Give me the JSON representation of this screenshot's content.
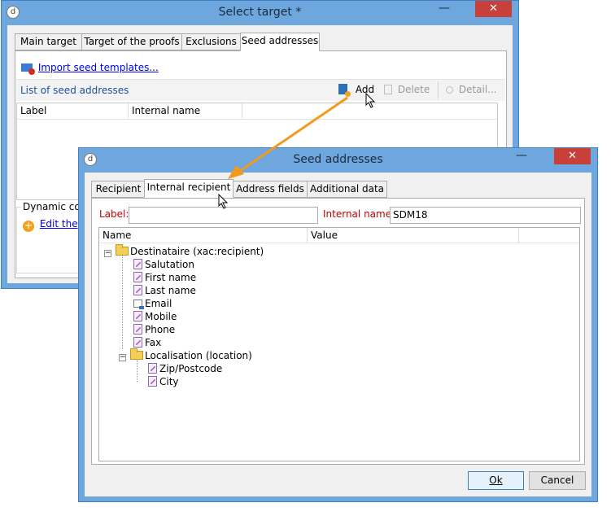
{
  "back_window": {
    "title": "Select target *",
    "close_glyph": "✕",
    "minimize_glyph": "—",
    "tabs": [
      "Main target",
      "Target of the proofs",
      "Exclusions",
      "Seed addresses"
    ],
    "import_link": "Import seed templates...",
    "list_label": "List of seed addresses",
    "toolbar": {
      "add": "Add",
      "delete": "Delete",
      "detail": "Detail..."
    },
    "columns": [
      "Label",
      "Internal name"
    ],
    "dynamic_label": "Dynamic co",
    "edit_link": "Edit the"
  },
  "front_window": {
    "title": "Seed addresses",
    "close_glyph": "✕",
    "minimize_glyph": "—",
    "tabs": [
      "Recipient",
      "Internal recipient",
      "Address fields",
      "Additional data"
    ],
    "label_caption": "Label:",
    "label_value": "",
    "internal_name_caption": "Internal name:",
    "internal_name_value": "SDM18",
    "grid_columns": [
      "Name",
      "Value"
    ],
    "tree": {
      "root": "Destinataire (xac:recipient)",
      "fields": [
        "Salutation",
        "First name",
        "Last name",
        "Email",
        "Mobile",
        "Phone",
        "Fax"
      ],
      "sub_folder": "Localisation (location)",
      "sub_fields": [
        "Zip/Postcode",
        "City"
      ]
    },
    "buttons": {
      "ok": "Ok",
      "cancel": "Cancel"
    }
  },
  "colors": {
    "title_bar": "#6ea6de",
    "close_button": "#c7413a",
    "annotation_arrow": "#f39a1e",
    "required_label": "#c00000"
  },
  "icons": [
    "app-icon",
    "minimize-icon",
    "close-icon",
    "envelope-icon",
    "add-icon",
    "delete-icon",
    "detail-icon",
    "plus-circle-icon",
    "folder-icon",
    "field-icon",
    "email-field-icon",
    "collapse-icon",
    "mouse-cursor-icon",
    "arrow-annotation"
  ]
}
